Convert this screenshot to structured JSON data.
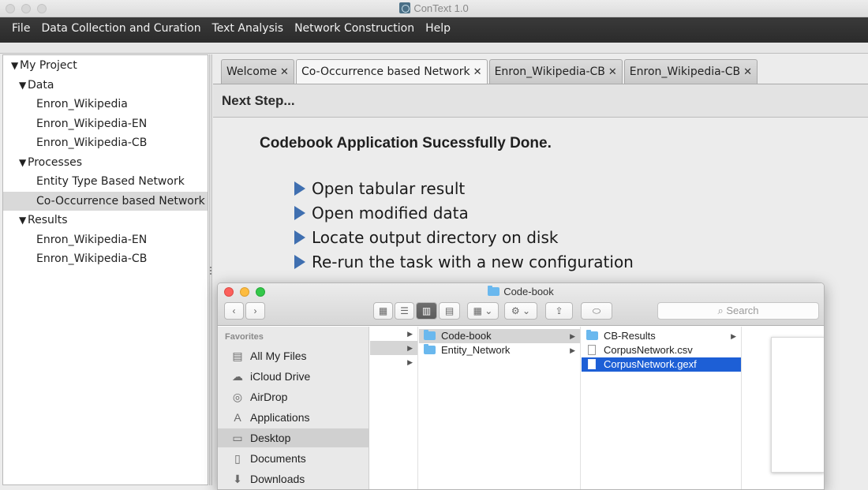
{
  "app": {
    "title": "ConText 1.0"
  },
  "menu": [
    "File",
    "Data Collection and Curation",
    "Text Analysis",
    "Network Construction",
    "Help"
  ],
  "tree": {
    "root": "My Project",
    "data_label": "Data",
    "data_items": [
      "Enron_Wikipedia",
      "Enron_Wikipedia-EN",
      "Enron_Wikipedia-CB"
    ],
    "processes_label": "Processes",
    "process_items": [
      "Entity Type Based Network",
      "Co-Occurrence based Network"
    ],
    "results_label": "Results",
    "result_items": [
      "Enron_Wikipedia-EN",
      "Enron_Wikipedia-CB"
    ],
    "selected": "Co-Occurrence based Network"
  },
  "tabs": [
    {
      "label": "Welcome",
      "active": false
    },
    {
      "label": "Co-Occurrence based Network",
      "active": true
    },
    {
      "label": "Enron_Wikipedia-CB",
      "active": false
    },
    {
      "label": "Enron_Wikipedia-CB",
      "active": false
    }
  ],
  "tab_close_glyph": "✕",
  "main": {
    "next_step": "Next Step...",
    "headline": "Codebook Application Sucessfully Done.",
    "actions": [
      "Open tabular result",
      "Open modified data",
      "Locate output directory on disk",
      "Re-run the task with a new configuration"
    ]
  },
  "finder": {
    "title": "Code-book",
    "search_placeholder": "Search",
    "favorites_header": "Favorites",
    "favorites": [
      {
        "label": "All My Files",
        "icon": "all-files-icon"
      },
      {
        "label": "iCloud Drive",
        "icon": "cloud-icon"
      },
      {
        "label": "AirDrop",
        "icon": "airdrop-icon"
      },
      {
        "label": "Applications",
        "icon": "applications-icon"
      },
      {
        "label": "Desktop",
        "icon": "desktop-icon",
        "selected": true
      },
      {
        "label": "Documents",
        "icon": "documents-icon"
      },
      {
        "label": "Downloads",
        "icon": "downloads-icon"
      }
    ],
    "column2": [
      {
        "label": "Code-book",
        "type": "folder",
        "highlight": true
      },
      {
        "label": "Entity_Network",
        "type": "folder"
      }
    ],
    "column3": [
      {
        "label": "CB-Results",
        "type": "folder"
      },
      {
        "label": "CorpusNetwork.csv",
        "type": "file"
      },
      {
        "label": "CorpusNetwork.gexf",
        "type": "file",
        "selected": true
      }
    ],
    "colors": {
      "selection": "#1d5fd6",
      "close_light": "#fc605c",
      "minimize_light": "#fdbc40",
      "zoom_light": "#34c84a"
    }
  },
  "colors": {
    "menubar": "#2b2b2b",
    "bullet": "#3f6fb0"
  }
}
